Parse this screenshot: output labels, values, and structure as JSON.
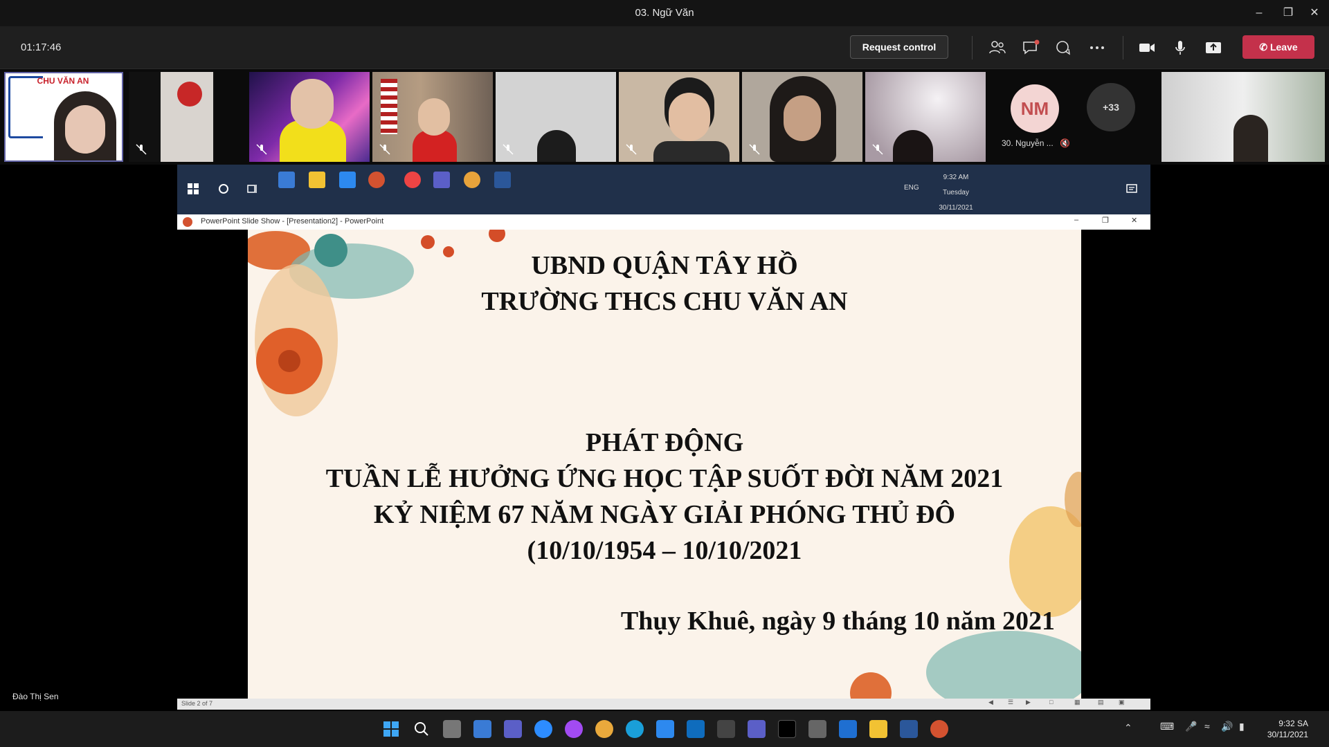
{
  "window": {
    "title": "03. Ngữ Văn"
  },
  "meeting": {
    "timer": "01:17:46",
    "request_control": "Request control",
    "leave": "Leave"
  },
  "participants": {
    "self_tile_text": "CHU VĂN AN",
    "nm_initials": "NM",
    "nm_name": "30. Nguyễn ...",
    "overflow": "+33"
  },
  "remote": {
    "lang": "ENG",
    "time": "9:32 AM",
    "day": "Tuesday",
    "date": "30/11/2021",
    "window_title": "PowerPoint Slide Show - [Presentation2] - PowerPoint",
    "status": "Slide 2 of 7"
  },
  "slide": {
    "line1": "UBND QUẬN TÂY HỒ",
    "line2": "TRƯỜNG THCS CHU VĂN AN",
    "line3": "PHÁT ĐỘNG",
    "line4": "TUẦN LỄ HƯỞNG ỨNG HỌC TẬP SUỐT ĐỜI NĂM 2021",
    "line5": "KỶ NIỆM 67 NĂM NGÀY GIẢI PHÓNG THỦ ĐÔ",
    "line6": "(10/10/1954 – 10/10/2021",
    "line7": "Thụy Khuê, ngày 9 tháng 10 năm 2021"
  },
  "presenter": {
    "name": "Đào Thị Sen"
  },
  "taskbar": {
    "time": "9:32 SA",
    "date": "30/11/2021"
  },
  "colors": {
    "leave": "#c4314b",
    "remote_taskbar": "#20304a",
    "slide_bg": "#fbf3ea"
  }
}
